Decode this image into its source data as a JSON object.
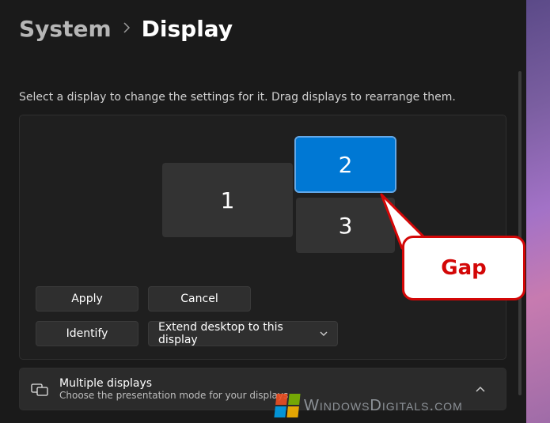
{
  "breadcrumb": {
    "parent": "System",
    "current": "Display"
  },
  "helper": "Select a display to change the settings for it. Drag displays to rearrange them.",
  "displays": {
    "d1": "1",
    "d2": "2",
    "d3": "3"
  },
  "buttons": {
    "apply": "Apply",
    "cancel": "Cancel",
    "identify": "Identify"
  },
  "dropdown": {
    "selected": "Extend desktop to this display"
  },
  "multiple_displays": {
    "title": "Multiple displays",
    "description": "Choose the presentation mode for your displays"
  },
  "callout": {
    "label": "Gap"
  },
  "watermark": "WindowsDigitals.com"
}
